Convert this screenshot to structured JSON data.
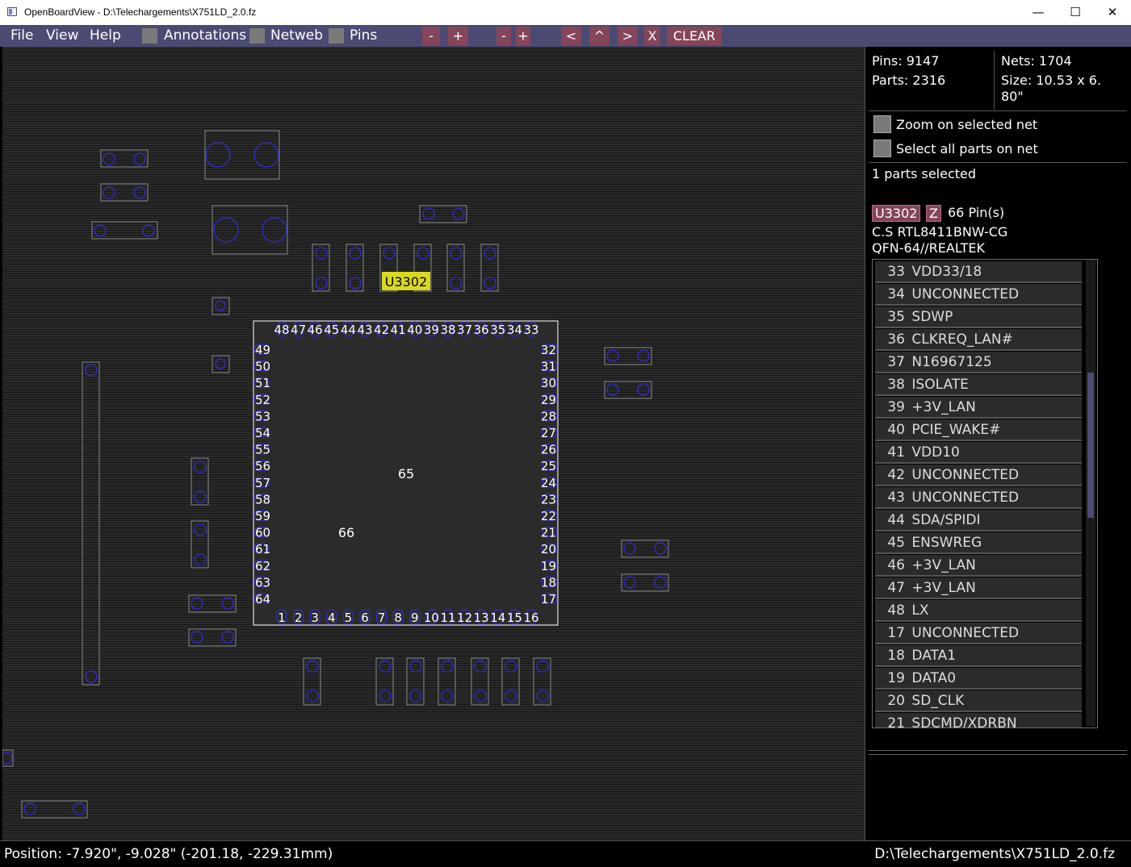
{
  "window": {
    "title": "OpenBoardView - D:\\Telechargements\\X751LD_2.0.fz",
    "minimize": "—",
    "maximize": "☐",
    "close": "✕"
  },
  "menu": {
    "file": "File",
    "view": "View",
    "help": "Help",
    "annotations": "Annotations",
    "netweb": "Netweb",
    "pins": "Pins",
    "buttons": [
      "-",
      "+",
      "-",
      "+",
      "<",
      "^",
      ">",
      "X",
      "CLEAR"
    ]
  },
  "board": {
    "selected_part": "U3302",
    "chip_top_pins": [
      "48",
      "47",
      "46",
      "45",
      "44",
      "43",
      "42",
      "41",
      "40",
      "39",
      "38",
      "37",
      "36",
      "35",
      "34",
      "33"
    ],
    "chip_left_pins": [
      "49",
      "50",
      "51",
      "52",
      "53",
      "54",
      "55",
      "56",
      "57",
      "58",
      "59",
      "60",
      "61",
      "62",
      "63",
      "64"
    ],
    "chip_right_pins": [
      "32",
      "31",
      "30",
      "29",
      "28",
      "27",
      "26",
      "25",
      "24",
      "23",
      "22",
      "21",
      "20",
      "19",
      "18",
      "17"
    ],
    "chip_bottom_pins": [
      "1",
      "2",
      "3",
      "4",
      "5",
      "6",
      "7",
      "8",
      "9",
      "10",
      "11",
      "12",
      "13",
      "14",
      "15",
      "16"
    ],
    "center_pin_a": "65",
    "center_pin_b": "66"
  },
  "panel": {
    "pins": "Pins: 9147",
    "nets": "Nets: 1704",
    "parts": "Parts: 2316",
    "size_line1": "Size: 10.53 x 6.",
    "size_line2": "80\"",
    "zoom_on_net": "Zoom on selected net",
    "select_all_parts": "Select all parts on net",
    "parts_selected": "1 parts selected",
    "part_name": "U3302",
    "part_z": "Z",
    "pin_count": "66 Pin(s)",
    "desc1": "C.S RTL8411BNW-CG",
    "desc2": "QFN-64//REALTEK",
    "pin_list": [
      {
        "num": "33",
        "net": "VDD33/18"
      },
      {
        "num": "34",
        "net": "UNCONNECTED"
      },
      {
        "num": "35",
        "net": "SDWP"
      },
      {
        "num": "36",
        "net": "CLKREQ_LAN#"
      },
      {
        "num": "37",
        "net": "N16967125"
      },
      {
        "num": "38",
        "net": "ISOLATE"
      },
      {
        "num": "39",
        "net": "+3V_LAN"
      },
      {
        "num": "40",
        "net": "PCIE_WAKE#"
      },
      {
        "num": "41",
        "net": "VDD10"
      },
      {
        "num": "42",
        "net": "UNCONNECTED"
      },
      {
        "num": "43",
        "net": "UNCONNECTED"
      },
      {
        "num": "44",
        "net": "SDA/SPIDI"
      },
      {
        "num": "45",
        "net": "ENSWREG"
      },
      {
        "num": "46",
        "net": "+3V_LAN"
      },
      {
        "num": "47",
        "net": "+3V_LAN"
      },
      {
        "num": "48",
        "net": "LX"
      },
      {
        "num": "17",
        "net": "UNCONNECTED"
      },
      {
        "num": "18",
        "net": "DATA1"
      },
      {
        "num": "19",
        "net": "DATA0"
      },
      {
        "num": "20",
        "net": "SD_CLK"
      },
      {
        "num": "21",
        "net": "SDCMD/XDRBN"
      }
    ]
  },
  "status": {
    "position": "Position: -7.920\", -9.028\" (-201.18, -229.31mm)",
    "file": "D:\\Telechargements\\X751LD_2.0.fz"
  }
}
